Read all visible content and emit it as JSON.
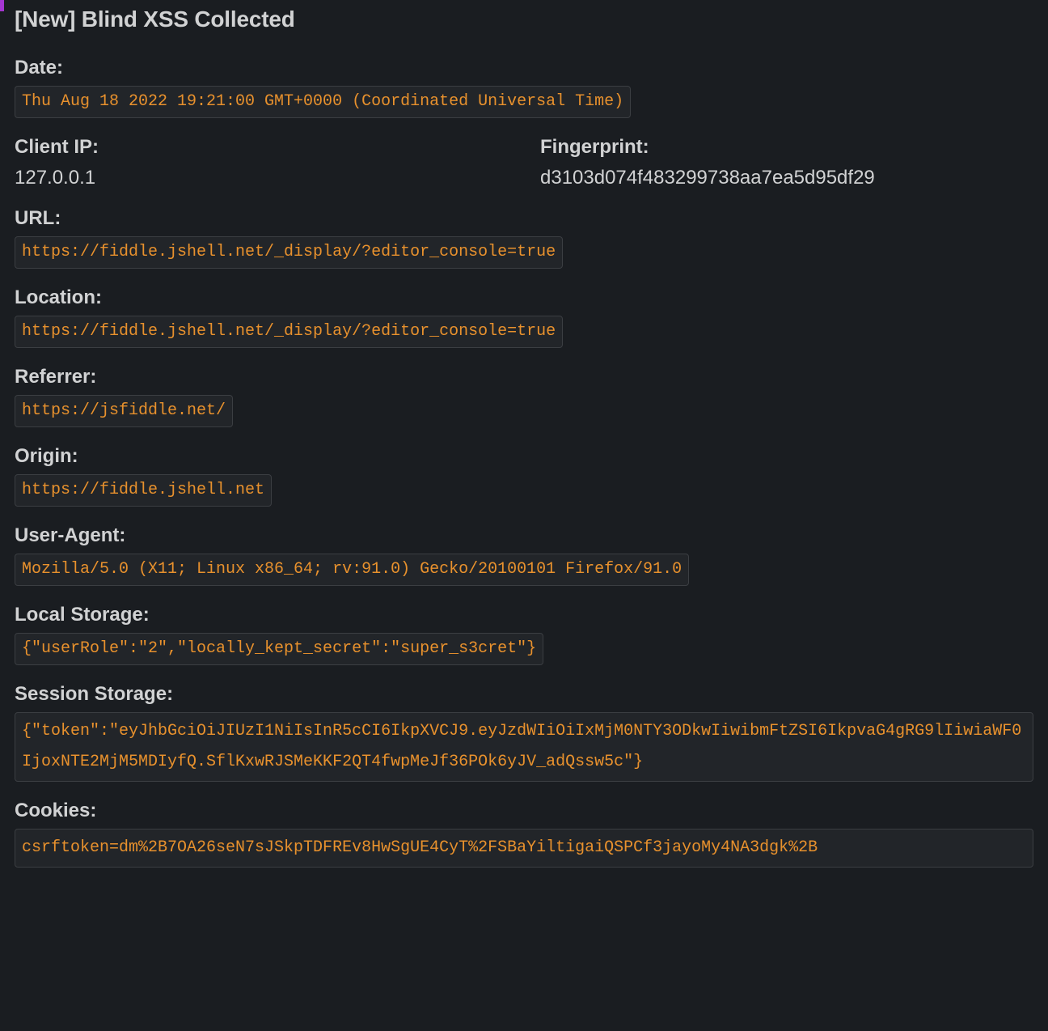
{
  "title": "[New] Blind XSS Collected",
  "fields": {
    "date": {
      "label": "Date:",
      "value": "Thu Aug 18 2022 19:21:00 GMT+0000 (Coordinated Universal Time)"
    },
    "client_ip": {
      "label": "Client IP:",
      "value": "127.0.0.1"
    },
    "fingerprint": {
      "label": "Fingerprint:",
      "value": "d3103d074f483299738aa7ea5d95df29"
    },
    "url": {
      "label": "URL:",
      "value": "https://fiddle.jshell.net/_display/?editor_console=true"
    },
    "location": {
      "label": "Location:",
      "value": "https://fiddle.jshell.net/_display/?editor_console=true"
    },
    "referrer": {
      "label": "Referrer:",
      "value": "https://jsfiddle.net/"
    },
    "origin": {
      "label": "Origin:",
      "value": "https://fiddle.jshell.net"
    },
    "user_agent": {
      "label": "User-Agent:",
      "value": "Mozilla/5.0 (X11; Linux x86_64; rv:91.0) Gecko/20100101 Firefox/91.0"
    },
    "local_storage": {
      "label": "Local Storage:",
      "value": "{\"userRole\":\"2\",\"locally_kept_secret\":\"super_s3cret\"}"
    },
    "session_storage": {
      "label": "Session Storage:",
      "value": "{\"token\":\"eyJhbGciOiJIUzI1NiIsInR5cCI6IkpXVCJ9.eyJzdWIiOiIxMjM0NTY3ODkwIiwibmFtZSI6IkpvaG4gRG9lIiwiaWF0IjoxNTE2MjM5MDIyfQ.SflKxwRJSMeKKF2QT4fwpMeJf36POk6yJV_adQssw5c\"}"
    },
    "cookies": {
      "label": "Cookies:",
      "value": "csrftoken=dm%2B7OA26seN7sJSkpTDFREv8HwSgUE4CyT%2FSBaYiltigaiQSPCf3jayoMy4NA3dgk%2B"
    }
  }
}
